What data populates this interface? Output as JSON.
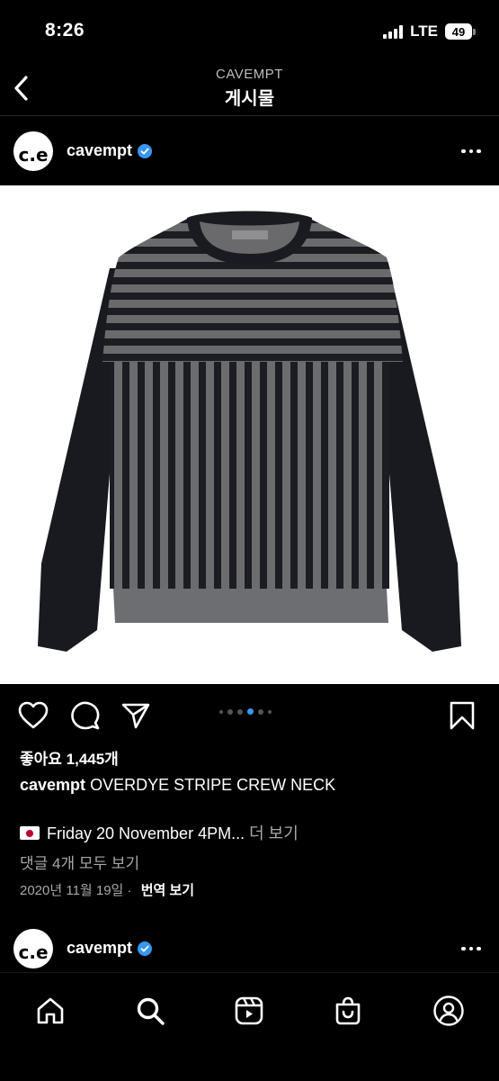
{
  "status_bar": {
    "time": "8:26",
    "network": "LTE",
    "battery": "49"
  },
  "header": {
    "subtitle": "CAVEMPT",
    "title": "게시물"
  },
  "post": {
    "username": "cavempt",
    "avatar_text": "c.e",
    "likes": "좋아요 1,445개",
    "caption_user": "cavempt",
    "caption_text": "OVERDYE STRIPE CREW NECK",
    "extra_text": "Friday 20 November 4PM...",
    "more_label": "더 보기",
    "comments_link": "댓글 4개 모두 보기",
    "date": "2020년 11월 19일",
    "translate_label": "번역 보기",
    "carousel": {
      "count": 6,
      "active_index": 3
    }
  },
  "next_post": {
    "username": "cavempt",
    "avatar_text": "c.e"
  },
  "colors": {
    "background": "#000000",
    "verified": "#3897f0",
    "active_dot": "#3897f0",
    "secondary_text": "#a8a8a8"
  },
  "bottom_nav": {
    "icons": [
      "home-icon",
      "search-icon",
      "reels-icon",
      "shop-icon",
      "profile-icon"
    ]
  }
}
